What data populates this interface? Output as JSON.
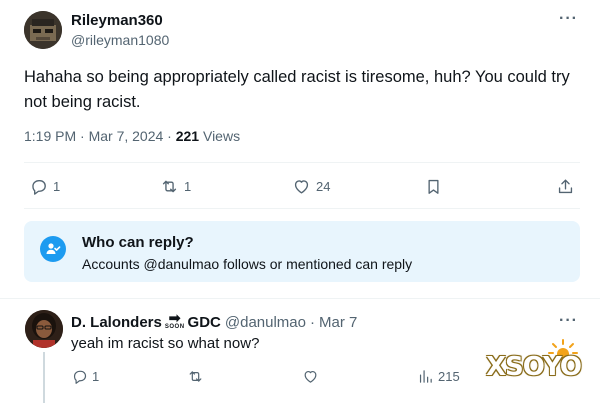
{
  "main_tweet": {
    "author_name": "Rileyman360",
    "author_handle": "@rileyman1080",
    "more": "···",
    "text": "Hahaha so being appropriately called racist is tiresome, huh? You could try not being racist.",
    "time": "1:19 PM · Mar 7, 2024 · ",
    "views_count": "221",
    "views_label": " Views",
    "actions": {
      "reply_count": "1",
      "retweet_count": "1",
      "like_count": "24"
    }
  },
  "who_can_reply": {
    "title": "Who can reply?",
    "subtitle": "Accounts @danulmao follows or mentioned can reply"
  },
  "reply_tweet": {
    "author_name": "D. Lalonders",
    "badge_arrow": "➡",
    "badge_text": "SOON",
    "author_suffix": "GDC",
    "author_handle": "@danulmao",
    "dot": "·",
    "date": "Mar 7",
    "more": "···",
    "text": "yeah im racist so what now?",
    "actions": {
      "reply_count": "1",
      "views_count": "215"
    }
  },
  "watermark": {
    "text": "XSOYO"
  },
  "icons": {
    "reply": "reply-icon",
    "retweet": "retweet-icon",
    "like": "heart-icon",
    "bookmark": "bookmark-icon",
    "share": "share-icon",
    "views": "views-icon",
    "who_can_reply": "user-check-icon",
    "more": "more-icon"
  },
  "colors": {
    "accent": "#1d9bf0",
    "reply_box_bg": "#e8f5fd",
    "secondary_text": "#536471",
    "primary_text": "#0f1419"
  }
}
